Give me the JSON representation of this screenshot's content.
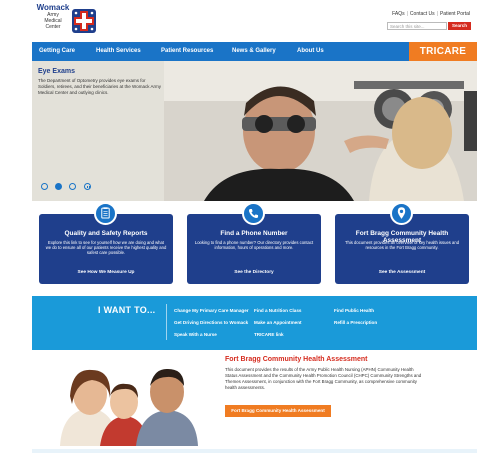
{
  "logo": {
    "name": "Womack",
    "sub": [
      "Army",
      "Medical",
      "Center"
    ]
  },
  "top_links": [
    "FAQs",
    "Contact Us",
    "Patient Portal"
  ],
  "search": {
    "placeholder": "Search this site...",
    "button": "Search"
  },
  "nav": {
    "items": [
      "Getting Care",
      "Health Services",
      "Patient Resources",
      "News & Gallery",
      "About Us"
    ],
    "tricare": "TRICARE"
  },
  "hero": {
    "title": "Eye Exams",
    "description": "The Department of Optometry provides eye exams for Soldiers, retirees, and their beneficiaries at the Womack Army Medical Center and outlying clinics."
  },
  "cards": [
    {
      "title": "Quality and Safety Reports",
      "description": "Explore this link to see for yourself how we are doing and what we do to ensure all of our patients receive the highest quality and safest care possible.",
      "link": "See How We Measure Up",
      "icon": "clipboard-icon"
    },
    {
      "title": "Find a Phone Number",
      "description": "Looking to find a phone number? Our directory provides contact information, hours of operations and more.",
      "link": "See the Directory",
      "icon": "phone-icon"
    },
    {
      "title": "Fort Bragg Community Health Assessment",
      "description": "This document provides an overview of key health issues and resources in the Fort Bragg community.",
      "link": "See the Assessment",
      "icon": "location-pin-icon"
    }
  ],
  "want": {
    "title": "I WANT TO...",
    "links": [
      [
        "Change My Primary Care Manager",
        "Get Driving Directions to Womack",
        "Speak With a Nurse"
      ],
      [
        "Find a Nutrition Class",
        "Make an Appointment",
        "TRICARE link"
      ],
      [
        "Find Public Health",
        "Refill a Prescription"
      ]
    ]
  },
  "feature": {
    "title": "Fort Bragg Community Health Assessment",
    "description": "This document provides the results of the Army Public Health Nursing (APHN) Community Health Status Assessment and the Community Health Promotion Council (CHPC) Community Strengths and Themes Assessment, in conjunction with the Fort Bragg Community, as comprehensive community health assessments.",
    "button": "Fort Bragg Community Health Assessment"
  },
  "colors": {
    "navy": "#1f3f8c",
    "blue": "#1a74c7",
    "light_blue": "#1a9ad9",
    "orange": "#f07c22",
    "red": "#d52b1e"
  }
}
